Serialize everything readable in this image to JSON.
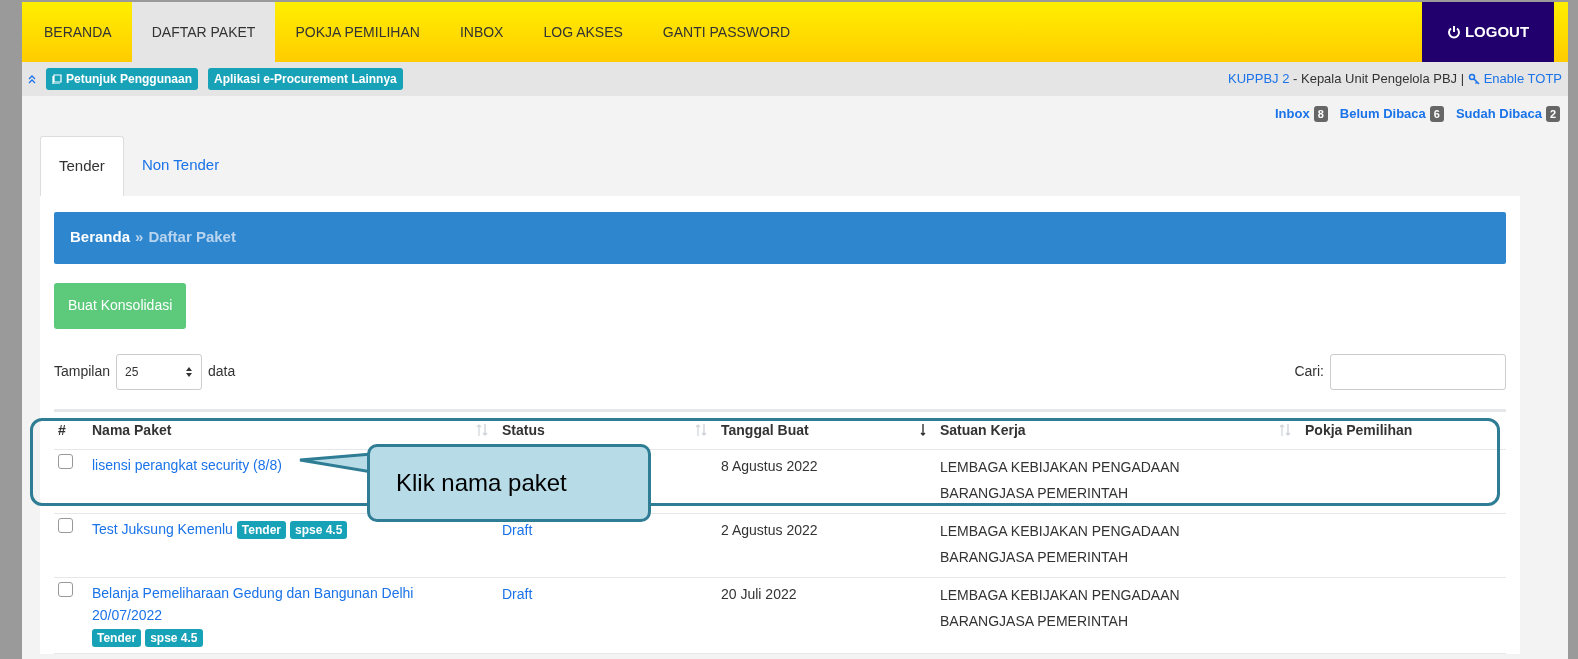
{
  "nav": {
    "items": [
      {
        "label": "BERANDA",
        "selected": false
      },
      {
        "label": "DAFTAR PAKET",
        "selected": true
      },
      {
        "label": "POKJA PEMILIHAN",
        "selected": false
      },
      {
        "label": "INBOX",
        "selected": false
      },
      {
        "label": "LOG AKSES",
        "selected": false
      },
      {
        "label": "GANTI PASSWORD",
        "selected": false
      }
    ],
    "logout": "LOGOUT"
  },
  "subbar": {
    "links": [
      "Petunjuk Penggunaan",
      "Aplikasi e-Procurement Lainnya"
    ],
    "user": "KUPPBJ 2",
    "role": " - Kepala Unit Pengelola PBJ | ",
    "totp": "Enable TOTP"
  },
  "messages": [
    {
      "label": "Inbox",
      "count": "8"
    },
    {
      "label": "Belum Dibaca",
      "count": "6"
    },
    {
      "label": "Sudah Dibaca",
      "count": "2"
    }
  ],
  "tabs": [
    {
      "label": "Tender",
      "selected": true
    },
    {
      "label": "Non Tender",
      "selected": false
    }
  ],
  "breadcrumb": {
    "home": "Beranda",
    "separator": "»",
    "current": "Daftar Paket"
  },
  "consolidate_button": "Buat Konsolidasi",
  "length": {
    "before": "Tampilan",
    "value": "25",
    "after": "data"
  },
  "search": {
    "label": "Cari:"
  },
  "table": {
    "columns": [
      {
        "label": "#",
        "sortable": false,
        "sorted": false
      },
      {
        "label": "Nama Paket",
        "sortable": true,
        "sorted": false
      },
      {
        "label": "Status",
        "sortable": true,
        "sorted": false
      },
      {
        "label": "Tanggal Buat",
        "sortable": true,
        "sorted": true
      },
      {
        "label": "Satuan Kerja",
        "sortable": true,
        "sorted": false
      },
      {
        "label": "Pokja Pemilihan",
        "sortable": false,
        "sorted": false
      }
    ],
    "rows": [
      {
        "checked": false,
        "name": "lisensi perangkat security (8/8)",
        "badges": [],
        "status": "",
        "date": "8 Agustus 2022",
        "unit": "LEMBAGA KEBIJAKAN PENGADAAN BARANGJASA PEMERINTAH"
      },
      {
        "checked": false,
        "name": "Test Juksung Kemenlu",
        "badges": [
          "Tender",
          "spse 4.5"
        ],
        "status": "Draft",
        "date": "2 Agustus 2022",
        "unit": "LEMBAGA KEBIJAKAN PENGADAAN BARANGJASA PEMERINTAH"
      },
      {
        "checked": false,
        "name": "Belanja Pemeliharaan Gedung dan Bangunan Delhi 20/07/2022",
        "badges": [
          "Tender",
          "spse 4.5"
        ],
        "status": "Draft",
        "date": "20 Juli 2022",
        "unit": "LEMBAGA KEBIJAKAN PENGADAAN BARANGJASA PEMERINTAH"
      }
    ]
  },
  "callout": {
    "text": "Klik nama paket"
  }
}
